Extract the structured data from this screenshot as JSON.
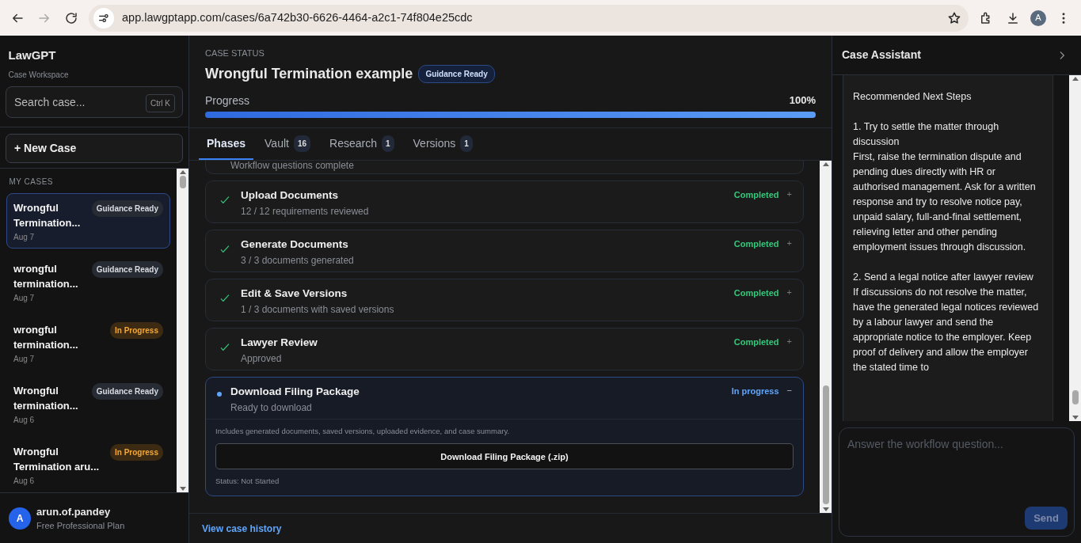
{
  "browser": {
    "url": "app.lawgptapp.com/cases/6a742b30-6626-4464-a2c1-74f804e25cdc",
    "profile_initial": "A"
  },
  "sidebar": {
    "brand": "LawGPT",
    "subtitle": "Case Workspace",
    "search": {
      "placeholder": "Search case...",
      "shortcut": "Ctrl K"
    },
    "new_case": "+ New Case",
    "section": "MY CASES",
    "cases": [
      {
        "title": "Wrongful Termination...",
        "status": "Guidance Ready",
        "kind": "ready",
        "date": "Aug 7",
        "selected": true
      },
      {
        "title": "wrongful termination...",
        "status": "Guidance Ready",
        "kind": "ready",
        "date": "Aug 7",
        "selected": false
      },
      {
        "title": "wrongful termination...",
        "status": "In Progress",
        "kind": "progress",
        "date": "Aug 7",
        "selected": false
      },
      {
        "title": "Wrongful termination...",
        "status": "Guidance Ready",
        "kind": "ready",
        "date": "Aug 6",
        "selected": false
      },
      {
        "title": "Wrongful Termination aru...",
        "status": "In Progress",
        "kind": "progress",
        "date": "Aug 6",
        "selected": false
      }
    ],
    "user": {
      "initial": "A",
      "name": "arun.of.pandey",
      "plan": "Free Professional Plan"
    }
  },
  "case": {
    "label": "CASE STATUS",
    "title": "Wrongful Termination example",
    "status": "Guidance Ready",
    "progress_label": "Progress",
    "progress_reading": "100%",
    "level": 1.0
  },
  "tabs": [
    {
      "label": "Phases",
      "selected": true
    },
    {
      "label": "Vault",
      "count": "16",
      "selected": false
    },
    {
      "label": "Research",
      "count": "1",
      "selected": false
    },
    {
      "label": "Versions",
      "count": "1",
      "selected": false
    }
  ],
  "phases": [
    {
      "kind": "partial",
      "subtitle": "Workflow questions complete"
    },
    {
      "kind": "done",
      "title": "Upload Documents",
      "subtitle": "12 / 12 requirements reviewed",
      "status": "Completed",
      "toggle": "+",
      "expanded": false
    },
    {
      "kind": "done",
      "title": "Generate Documents",
      "subtitle": "3 / 3 documents generated",
      "status": "Completed",
      "toggle": "+",
      "expanded": false
    },
    {
      "kind": "done",
      "title": "Edit & Save Versions",
      "subtitle": "1 / 3 documents with saved versions",
      "status": "Completed",
      "toggle": "+",
      "expanded": false
    },
    {
      "kind": "done",
      "title": "Lawyer Review",
      "subtitle": "Approved",
      "status": "Completed",
      "toggle": "+",
      "expanded": false
    },
    {
      "kind": "active",
      "title": "Download Filing Package",
      "subtitle": "Ready to download",
      "status": "In progress",
      "toggle": "−",
      "expanded": true,
      "note": "Includes generated documents, saved versions, uploaded evidence, and case summary.",
      "button": "Download Filing Package (.zip)",
      "footer": "Status: Not Started"
    }
  ],
  "history_link": "View case history",
  "assistant": {
    "title": "Case Assistant",
    "paragraphs": [
      "Recommended Next Steps",
      "1. Try to settle the matter through discussion\nFirst, raise the termination dispute and pending dues directly with HR or authorised management. Ask for a written response and try to resolve notice pay, unpaid salary, full-and-final settlement, relieving letter and other pending employment issues through discussion.",
      "2. Send a legal notice after lawyer review\nIf discussions do not resolve the matter, have the generated legal notices reviewed by a labour lawyer and send the appropriate notice to the employer. Keep proof of delivery and allow the employer the stated time to"
    ],
    "input": {
      "placeholder": "Answer the workflow question..."
    },
    "send": "Send"
  }
}
